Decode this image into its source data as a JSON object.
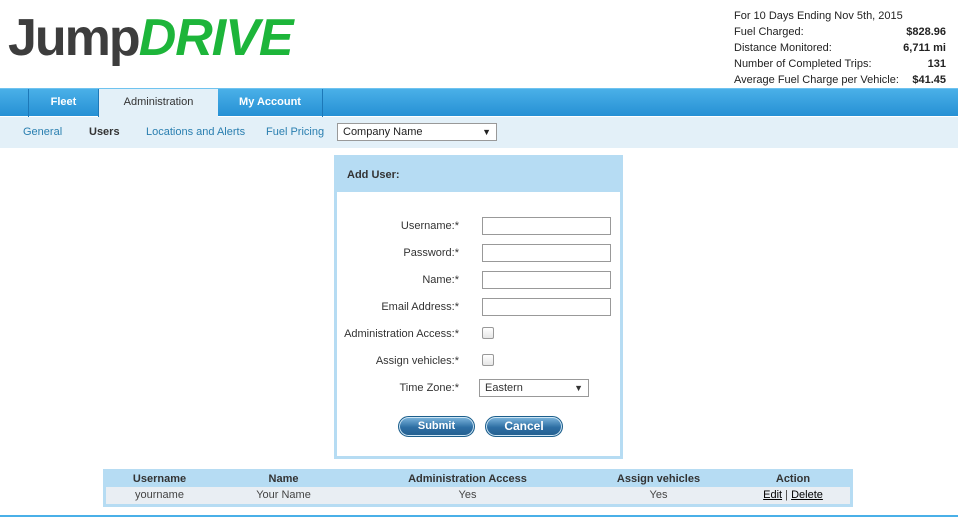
{
  "logo": {
    "part1": "Jump",
    "part2": "DRIVE"
  },
  "stats": {
    "period": "For 10 Days Ending Nov 5th, 2015",
    "rows": [
      {
        "label": "Fuel Charged:",
        "value": "$828.96"
      },
      {
        "label": "Distance Monitored:",
        "value": "6,711 mi"
      },
      {
        "label": "Number of Completed Trips:",
        "value": "131"
      },
      {
        "label": "Average Fuel Charge per Vehicle:",
        "value": "$41.45"
      }
    ]
  },
  "nav": {
    "tabs": [
      "Fleet",
      "Administration",
      "My Account"
    ],
    "active": "Administration"
  },
  "subnav": {
    "links": [
      "General",
      "Users",
      "Locations and Alerts",
      "Fuel Pricing"
    ],
    "active": "Users",
    "company_select": "Company Name"
  },
  "form": {
    "title": "Add User:",
    "fields": {
      "username": "Username:*",
      "password": "Password:*",
      "name": "Name:*",
      "email": "Email Address:*",
      "admin_access": "Administration Access:*",
      "assign_vehicles": "Assign vehicles:*",
      "time_zone": "Time Zone:*"
    },
    "time_zone_value": "Eastern",
    "submit_label": "Submit",
    "cancel_label": "Cancel"
  },
  "table": {
    "headers": [
      "Username",
      "Name",
      "Administration Access",
      "Assign vehicles",
      "Action"
    ],
    "rows": [
      {
        "username": "yourname",
        "name": "Your Name",
        "admin": "Yes",
        "assign": "Yes",
        "edit": "Edit",
        "sep": "|",
        "delete": "Delete"
      }
    ]
  },
  "colors": {
    "accent": "#2690d4",
    "subnav_bg": "#e3f0f8",
    "panel_border": "#b6dcf3",
    "brand_green": "#1db53a"
  }
}
